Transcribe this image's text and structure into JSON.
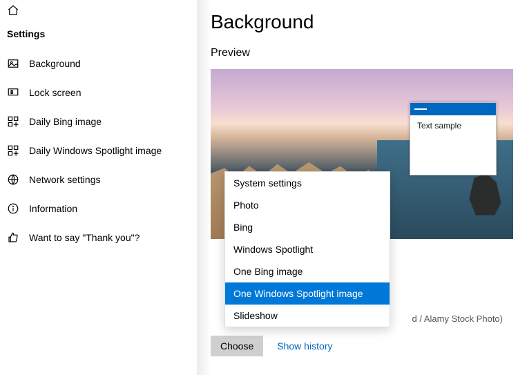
{
  "sidebar": {
    "title": "Settings",
    "items": [
      {
        "label": "Background"
      },
      {
        "label": "Lock screen"
      },
      {
        "label": "Daily Bing image"
      },
      {
        "label": "Daily Windows Spotlight image"
      },
      {
        "label": "Network settings"
      },
      {
        "label": "Information"
      },
      {
        "label": "Want to say \"Thank you\"?"
      }
    ]
  },
  "page": {
    "title": "Background",
    "preview_label": "Preview",
    "text_sample": "Text sample",
    "credit": "d / Alamy Stock Photo)",
    "choose_button": "Choose",
    "history_link": "Show history"
  },
  "menu": {
    "items": [
      "System settings",
      "Photo",
      "Bing",
      "Windows Spotlight",
      "One Bing image",
      "One Windows Spotlight image",
      "Slideshow"
    ],
    "selected_index": 5
  }
}
